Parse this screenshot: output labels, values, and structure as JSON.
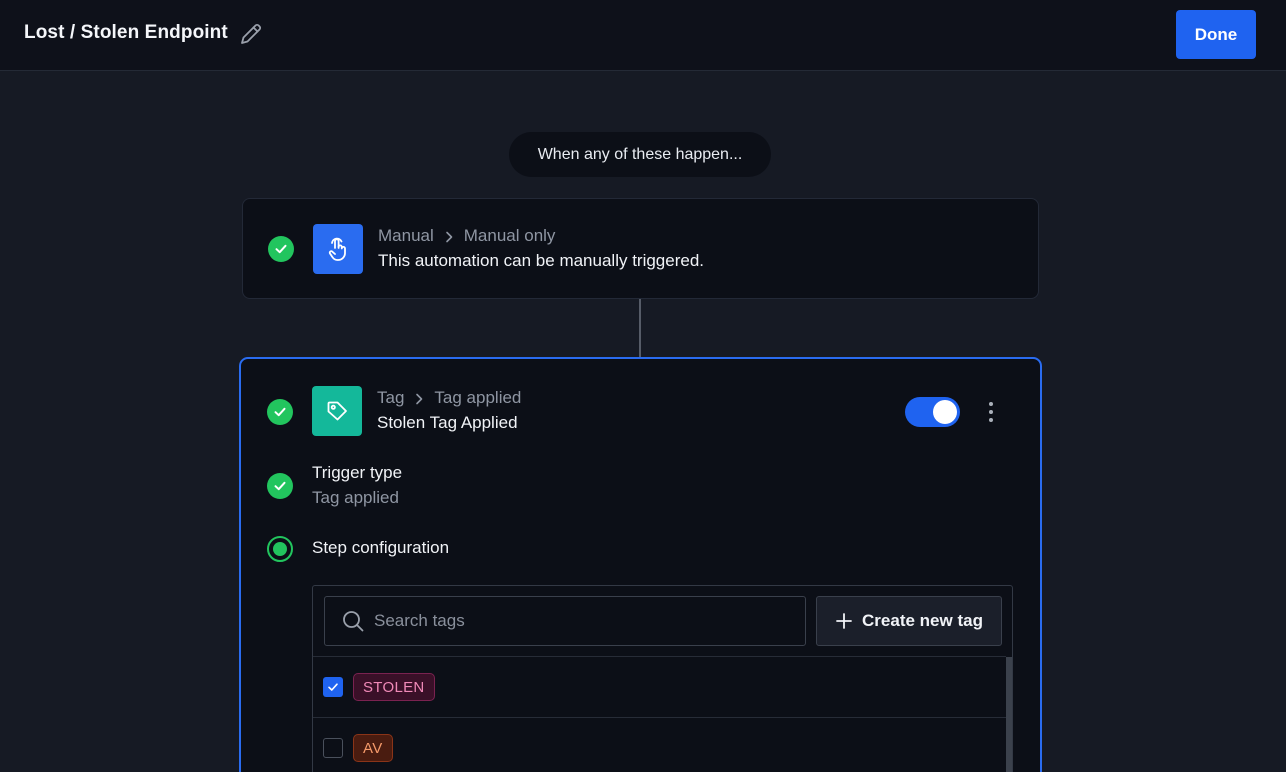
{
  "header": {
    "title": "Lost / Stolen Endpoint",
    "done_label": "Done"
  },
  "flow": {
    "intro": "When any of these happen..."
  },
  "trigger_manual": {
    "category": "Manual",
    "subcategory": "Manual only",
    "description": "This automation can be manually triggered.",
    "icon": "hand-pointer-icon",
    "icon_color": "#2a6cf0"
  },
  "trigger_tag": {
    "category": "Tag",
    "subcategory": "Tag applied",
    "name": "Stolen Tag Applied",
    "icon": "tag-icon",
    "icon_color": "#14b89a",
    "enabled": true,
    "trigger_type_label": "Trigger type",
    "trigger_type_value": "Tag applied",
    "step_config_label": "Step configuration"
  },
  "tags_panel": {
    "search_placeholder": "Search tags",
    "create_label": "Create new tag",
    "items": [
      {
        "label": "STOLEN",
        "checked": true,
        "bg": "#3a1028",
        "border": "#7a2250",
        "color": "#f08ab8"
      },
      {
        "label": "AV",
        "checked": false,
        "bg": "#4a1c10",
        "border": "#8a3418",
        "color": "#f59a6a"
      }
    ]
  },
  "colors": {
    "accent": "#1f63f0",
    "success": "#22c55e",
    "background": "#161a24",
    "card": "#0c0f17"
  }
}
